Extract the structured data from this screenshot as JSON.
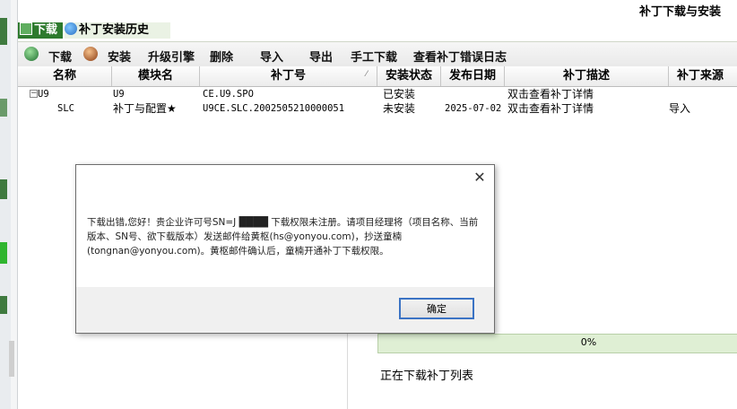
{
  "window": {
    "title": "补丁下载与安装"
  },
  "tabs": [
    {
      "label": "下载",
      "active": true
    },
    {
      "label": "补丁安装历史",
      "active": false
    }
  ],
  "toolbar": {
    "download": "下载",
    "install": "安装",
    "upgrade_engine": "升级引擎",
    "delete": "删除",
    "import": "导入",
    "export": "导出",
    "manual_download": "手工下载",
    "view_error_log": "查看补丁错误日志"
  },
  "table": {
    "columns": [
      "名称",
      "模块名",
      "补丁号",
      "安装状态",
      "发布日期",
      "补丁描述",
      "补丁来源"
    ],
    "rows": [
      {
        "name": "U9",
        "module": "U9",
        "patch_no": "CE.U9.SPO",
        "status": "已安装",
        "date": "",
        "desc": "双击查看补丁详情",
        "source": ""
      },
      {
        "name": "SLC",
        "module": "补丁与配置★",
        "patch_no": "U9CE.SLC.2002505210000051",
        "status": "未安装",
        "date": "2025-07-02",
        "desc": "双击查看补丁详情",
        "source": "导入"
      }
    ]
  },
  "progress": {
    "percent_label": "0%",
    "value": 0
  },
  "status": {
    "text": "正在下载补丁列表"
  },
  "dialog": {
    "message": "下载出错,您好！贵企业许可号SN=J ████ 下载权限未注册。请项目经理将（项目名称、当前版本、SN号、欲下载版本）发送邮件给黄枢(hs@yonyou.com)，抄送童楠(tongnan@yonyou.com)。黄枢邮件确认后，童楠开通补丁下载权限。",
    "ok_label": "确定",
    "close_glyph": "✕"
  },
  "colors": {
    "accent_green": "#2d7a2d",
    "button_border": "#3b73c4"
  }
}
